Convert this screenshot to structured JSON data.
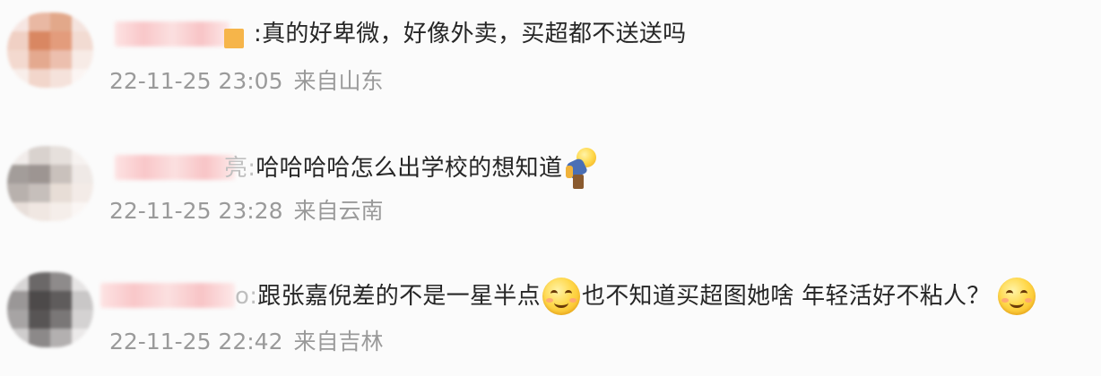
{
  "comments": [
    {
      "content_prefix": ":",
      "text": "真的好卑微，好像外卖，买超都不送送吗",
      "time": "22-11-25 23:05",
      "location": "来自山东"
    },
    {
      "content_prefix": "亮:",
      "text": "哈哈哈哈怎么出学校的想知道",
      "emoji": "bowing-person-icon",
      "time": "22-11-25 23:28",
      "location": "来自云南"
    },
    {
      "content_prefix": "o:",
      "text": "跟张嘉倪差的不是一星半点",
      "text2": "也不知道买超图她啥 年轻活好不粘人？",
      "emoji": "smile-icon",
      "time": "22-11-25 22:42",
      "location": "来自吉林"
    }
  ],
  "colors": {
    "text": "#262626",
    "meta": "#9a9a9a",
    "background": "#fbfbfb"
  }
}
